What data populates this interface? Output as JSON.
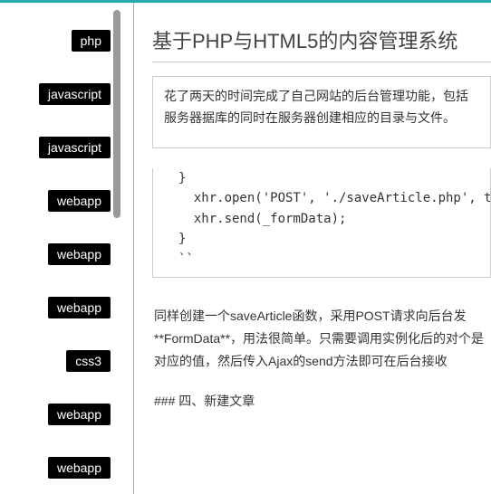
{
  "sidebar": {
    "tags": [
      "php",
      "javascript",
      "javascript",
      "webapp",
      "webapp",
      "webapp",
      "css3",
      "webapp",
      "webapp"
    ]
  },
  "article": {
    "title": "基于PHP与HTML5的内容管理系统",
    "summary": "花了两天的时间完成了自己网站的后台管理功能，包括服务器据库的同时在服务器创建相应的目录与文件。",
    "code": "}\n  xhr.open('POST', './saveArticle.php', true);   //该请求\n  xhr.send(_formData);\n}\n``",
    "paragraph1": "同样创建一个saveArticle函数，采用POST请求向后台发**FormData**，用法很简单。只需要调用实例化后的对个是对应的值，然后传入Ajax的send方法即可在后台接收",
    "heading1": "### 四、新建文章"
  }
}
